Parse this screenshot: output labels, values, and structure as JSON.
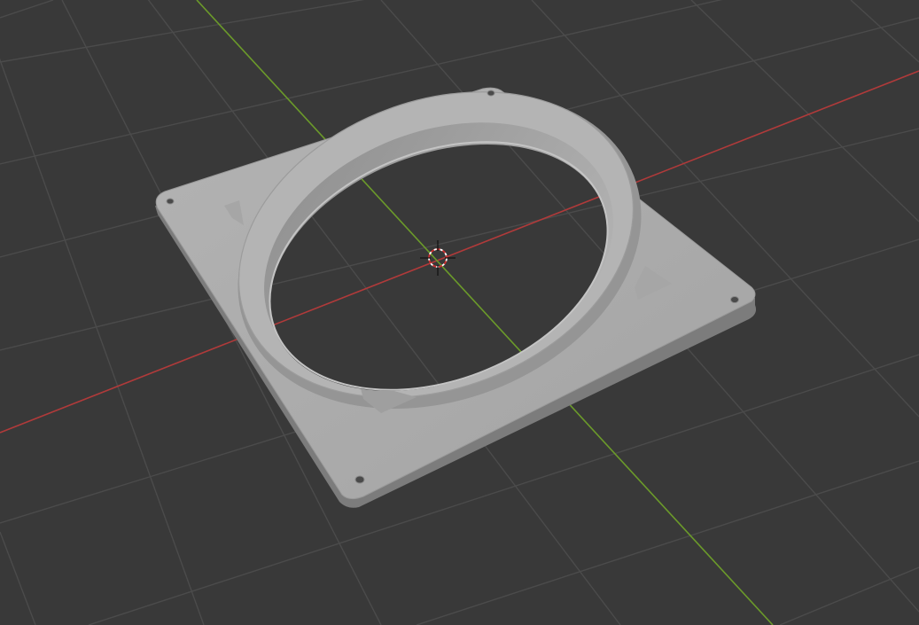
{
  "viewport": {
    "background": "#393939",
    "grid_color": "#4a4a4a",
    "x_axis_color": "#c0392b",
    "y_axis_color": "#6fa028"
  },
  "object": {
    "type": "fan-mount-plate",
    "color": "#a9a9a9",
    "mounting_holes": 4
  },
  "cursor": {
    "icon": "3d-cursor-icon"
  }
}
